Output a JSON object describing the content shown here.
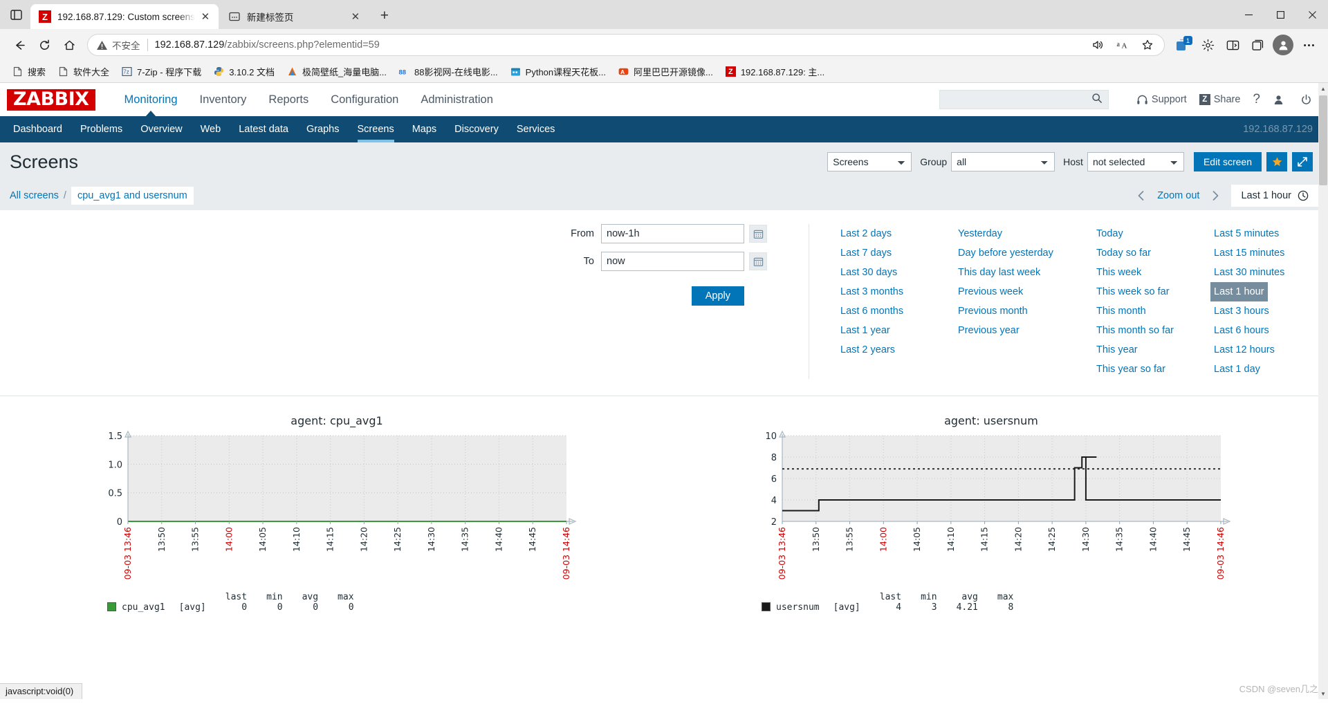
{
  "browser": {
    "sidebar_icon": "split-pane-icon",
    "tabs": [
      {
        "title": "192.168.87.129: Custom screens",
        "favicon": "zabbix-favicon",
        "active": true
      },
      {
        "title": "新建标签页",
        "favicon": "newtab-favicon",
        "active": false
      }
    ],
    "new_tab_label": "+",
    "window_controls": {
      "minimize": "—",
      "maximize": "☐",
      "close": "✕"
    },
    "toolbar": {
      "back": "back-arrow-icon",
      "refresh": "refresh-icon",
      "home": "home-icon",
      "security_label": "不安全",
      "url": "192.168.87.129",
      "url_path": "/zabbix/screens.php?elementid=59",
      "url_full": "192.168.87.129/zabbix/screens.php?elementid=59",
      "read_aloud": "read-aloud-icon",
      "translate": "translate-icon",
      "favorite": "add-favorite-icon",
      "collections_badge": "1",
      "settings": "browser-essentials-icon",
      "split_screen": "split-screen-icon",
      "collections": "collections-icon",
      "profile": "profile-avatar-icon",
      "more": "more-options-icon"
    },
    "bookmarks": [
      {
        "label": "搜索",
        "icon": "page-icon"
      },
      {
        "label": "软件大全",
        "icon": "page-icon"
      },
      {
        "label": "7-Zip - 程序下载",
        "icon": "7zip-icon"
      },
      {
        "label": "3.10.2 文档",
        "icon": "python-icon"
      },
      {
        "label": "极简壁纸_海量电脑...",
        "icon": "wallpaper-icon"
      },
      {
        "label": "88影视网-在线电影...",
        "icon": "88-icon"
      },
      {
        "label": "Python课程天花板...",
        "icon": "calendar-icon"
      },
      {
        "label": "阿里巴巴开源镜像...",
        "icon": "alibaba-icon"
      },
      {
        "label": "192.168.87.129: 主...",
        "icon": "zabbix-favicon"
      }
    ]
  },
  "zabbix": {
    "logo": "ZABBIX",
    "main_nav": [
      {
        "label": "Monitoring",
        "selected": true
      },
      {
        "label": "Inventory",
        "selected": false
      },
      {
        "label": "Reports",
        "selected": false
      },
      {
        "label": "Configuration",
        "selected": false
      },
      {
        "label": "Administration",
        "selected": false
      }
    ],
    "search": {
      "value": "",
      "placeholder": ""
    },
    "header_actions": [
      {
        "label": "Support",
        "icon": "headset-icon"
      },
      {
        "label": "Share",
        "icon": "zabbix-share-icon"
      },
      {
        "label": "?",
        "icon": "help-icon"
      },
      {
        "label": "",
        "icon": "user-icon"
      },
      {
        "label": "",
        "icon": "power-icon"
      }
    ],
    "sub_nav": [
      {
        "label": "Dashboard",
        "selected": false
      },
      {
        "label": "Problems",
        "selected": false
      },
      {
        "label": "Overview",
        "selected": false
      },
      {
        "label": "Web",
        "selected": false
      },
      {
        "label": "Latest data",
        "selected": false
      },
      {
        "label": "Graphs",
        "selected": false
      },
      {
        "label": "Screens",
        "selected": true
      },
      {
        "label": "Maps",
        "selected": false
      },
      {
        "label": "Discovery",
        "selected": false
      },
      {
        "label": "Services",
        "selected": false
      }
    ],
    "server_label": "192.168.87.129",
    "page_title": "Screens",
    "controls": {
      "view_select": "Screens",
      "group_label": "Group",
      "group_select": "all",
      "host_label": "Host",
      "host_select": "not selected",
      "edit_screen_label": "Edit screen",
      "favorite_icon": "star-icon",
      "kiosk_icon": "fullscreen-icon"
    },
    "breadcrumb": {
      "root": "All screens",
      "separator": "/",
      "current": "cpu_avg1 and usersnum"
    },
    "time_nav": {
      "prev_icon": "chevron-left-icon",
      "zoom_out": "Zoom out",
      "next_icon": "chevron-right-icon",
      "current_range": "Last 1 hour",
      "clock_icon": "clock-icon"
    },
    "filter": {
      "from_label": "From",
      "from_value": "now-1h",
      "to_label": "To",
      "to_value": "now",
      "calendar_icon": "calendar-icon",
      "apply_label": "Apply",
      "ranges_col1": [
        {
          "label": "Last 2 days",
          "selected": false
        },
        {
          "label": "Last 7 days",
          "selected": false
        },
        {
          "label": "Last 30 days",
          "selected": false
        },
        {
          "label": "Last 3 months",
          "selected": false
        },
        {
          "label": "Last 6 months",
          "selected": false
        },
        {
          "label": "Last 1 year",
          "selected": false
        },
        {
          "label": "Last 2 years",
          "selected": false
        }
      ],
      "ranges_col2": [
        {
          "label": "Yesterday",
          "selected": false
        },
        {
          "label": "Day before yesterday",
          "selected": false
        },
        {
          "label": "This day last week",
          "selected": false
        },
        {
          "label": "Previous week",
          "selected": false
        },
        {
          "label": "Previous month",
          "selected": false
        },
        {
          "label": "Previous year",
          "selected": false
        }
      ],
      "ranges_col3": [
        {
          "label": "Today",
          "selected": false
        },
        {
          "label": "Today so far",
          "selected": false
        },
        {
          "label": "This week",
          "selected": false
        },
        {
          "label": "This week so far",
          "selected": false
        },
        {
          "label": "This month",
          "selected": false
        },
        {
          "label": "This month so far",
          "selected": false
        },
        {
          "label": "This year",
          "selected": false
        },
        {
          "label": "This year so far",
          "selected": false
        }
      ],
      "ranges_col4": [
        {
          "label": "Last 5 minutes",
          "selected": false
        },
        {
          "label": "Last 15 minutes",
          "selected": false
        },
        {
          "label": "Last 30 minutes",
          "selected": false
        },
        {
          "label": "Last 1 hour",
          "selected": true
        },
        {
          "label": "Last 3 hours",
          "selected": false
        },
        {
          "label": "Last 6 hours",
          "selected": false
        },
        {
          "label": "Last 12 hours",
          "selected": false
        },
        {
          "label": "Last 1 day",
          "selected": false
        }
      ]
    }
  },
  "chart_data": [
    {
      "type": "line",
      "title": "agent: cpu_avg1",
      "xlabel": "",
      "ylabel": "",
      "ylim": [
        0,
        1.5
      ],
      "yticks": [
        "0",
        "0.5",
        "1.0",
        "1.5"
      ],
      "grid": true,
      "start_label": "09-03 13:46",
      "end_label": "09-03 14:46",
      "xticks": [
        "13:46",
        "13:50",
        "13:55",
        "14:00",
        "14:05",
        "14:10",
        "14:15",
        "14:20",
        "14:25",
        "14:30",
        "14:35",
        "14:40",
        "14:45",
        "14:46"
      ],
      "xticks_highlight": [
        "13:46",
        "14:00",
        "14:46"
      ],
      "series": [
        {
          "name": "cpu_avg1",
          "color": "#3a9a3a",
          "aggregate": "[avg]",
          "values": [
            0,
            0,
            0,
            0,
            0,
            0,
            0,
            0,
            0,
            0,
            0,
            0,
            0,
            0
          ],
          "last": "0",
          "min": "0",
          "avg": "0",
          "max": "0"
        }
      ],
      "legend_headers": [
        "last",
        "min",
        "avg",
        "max"
      ]
    },
    {
      "type": "line",
      "title": "agent: usersnum",
      "xlabel": "",
      "ylabel": "",
      "ylim": [
        2,
        10
      ],
      "yticks": [
        "2",
        "4",
        "6",
        "8",
        "10"
      ],
      "grid": true,
      "start_label": "09-03 13:46",
      "end_label": "09-03 14:46",
      "xticks": [
        "13:46",
        "13:50",
        "13:55",
        "14:00",
        "14:05",
        "14:10",
        "14:15",
        "14:20",
        "14:25",
        "14:30",
        "14:35",
        "14:40",
        "14:45",
        "14:46"
      ],
      "xticks_highlight": [
        "13:46",
        "14:00",
        "14:46"
      ],
      "trigger_line": 6.9,
      "series": [
        {
          "name": "usersnum",
          "color": "#1a1a1a",
          "aggregate": "[avg]",
          "x": [
            "13:46",
            "13:50",
            "13:51",
            "14:25",
            "14:26",
            "14:27",
            "14:29",
            "14:30",
            "14:46"
          ],
          "values": [
            3,
            3,
            4,
            4,
            7,
            8,
            8,
            4,
            4
          ],
          "last": "4",
          "min": "3",
          "avg": "4.21",
          "max": "8"
        }
      ],
      "legend_headers": [
        "last",
        "min",
        "avg",
        "max"
      ]
    }
  ],
  "status_bar": {
    "text": "javascript:void(0)"
  },
  "watermark": {
    "text": "CSDN @seven几之"
  }
}
